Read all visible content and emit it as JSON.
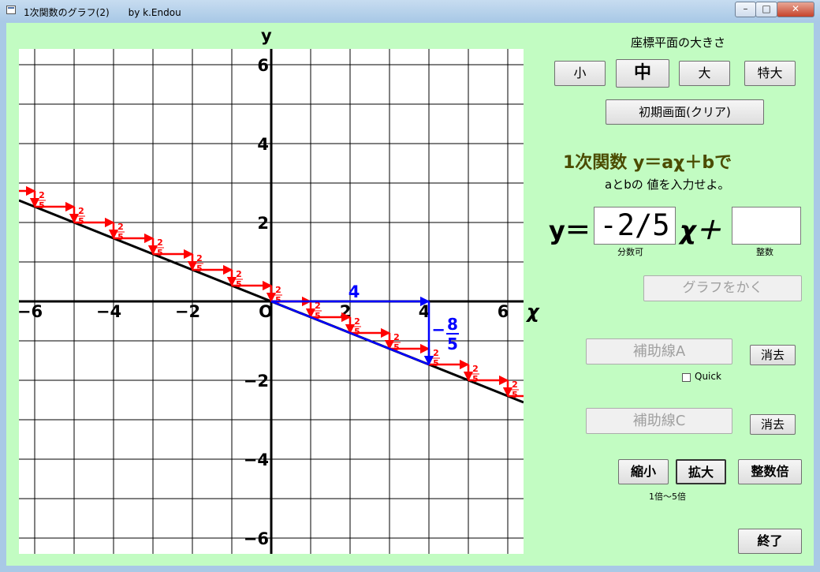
{
  "window": {
    "title": "1次関数のグラフ(2)　　by k.Endou",
    "controls": {
      "minimize": "–",
      "maximize": "□",
      "close": "✕"
    }
  },
  "graph": {
    "y_label": "y",
    "x_label": "χ",
    "origin_label": "O",
    "x_ticks": [
      "-6",
      "-4",
      "-2",
      "2",
      "4",
      "6"
    ],
    "y_ticks": [
      "6",
      "4",
      "2",
      "-2",
      "-4",
      "-6"
    ],
    "step_label": "2/5",
    "run_label": "4",
    "rise_label": "-8/5",
    "colors": {
      "line": "#000000",
      "steps": "#ff0000",
      "triangle": "#0000ff",
      "grid": "#000000"
    }
  },
  "chart_data": {
    "type": "line",
    "xlabel": "χ",
    "ylabel": "y",
    "xlim": [
      -6.4,
      6.4
    ],
    "ylim": [
      -6.4,
      6.4
    ],
    "grid": true,
    "series": [
      {
        "x": [
          -6.4,
          6.4
        ],
        "y": [
          2.56,
          -2.56
        ]
      }
    ],
    "slope": "-2/5",
    "intercept": 0,
    "slope_triangle": {
      "from": [
        0,
        0
      ],
      "run": 4,
      "rise": -1.6
    }
  },
  "panel": {
    "size_heading": "座標平面の大きさ",
    "size_buttons": [
      "小",
      "中",
      "大",
      "特大"
    ],
    "clear_button": "初期画面(クリア)",
    "heading": "1次関数 y＝aχ＋bで",
    "subheading": "aとbの 値を入力せよ。",
    "eq_prefix": "y＝",
    "a_value": "-2/5",
    "eq_mid": "χ＋",
    "b_value": "",
    "a_hint": "分数可",
    "b_hint": "整数",
    "draw_button": "グラフをかく",
    "aux_a_button": "補助線A",
    "erase_label": "消去",
    "quick_label": "Quick",
    "aux_c_button": "補助線C",
    "shrink_button": "縮小",
    "enlarge_button": "拡大",
    "integer_button": "整数倍",
    "zoom_range": "1倍～5倍",
    "exit_button": "終了"
  }
}
